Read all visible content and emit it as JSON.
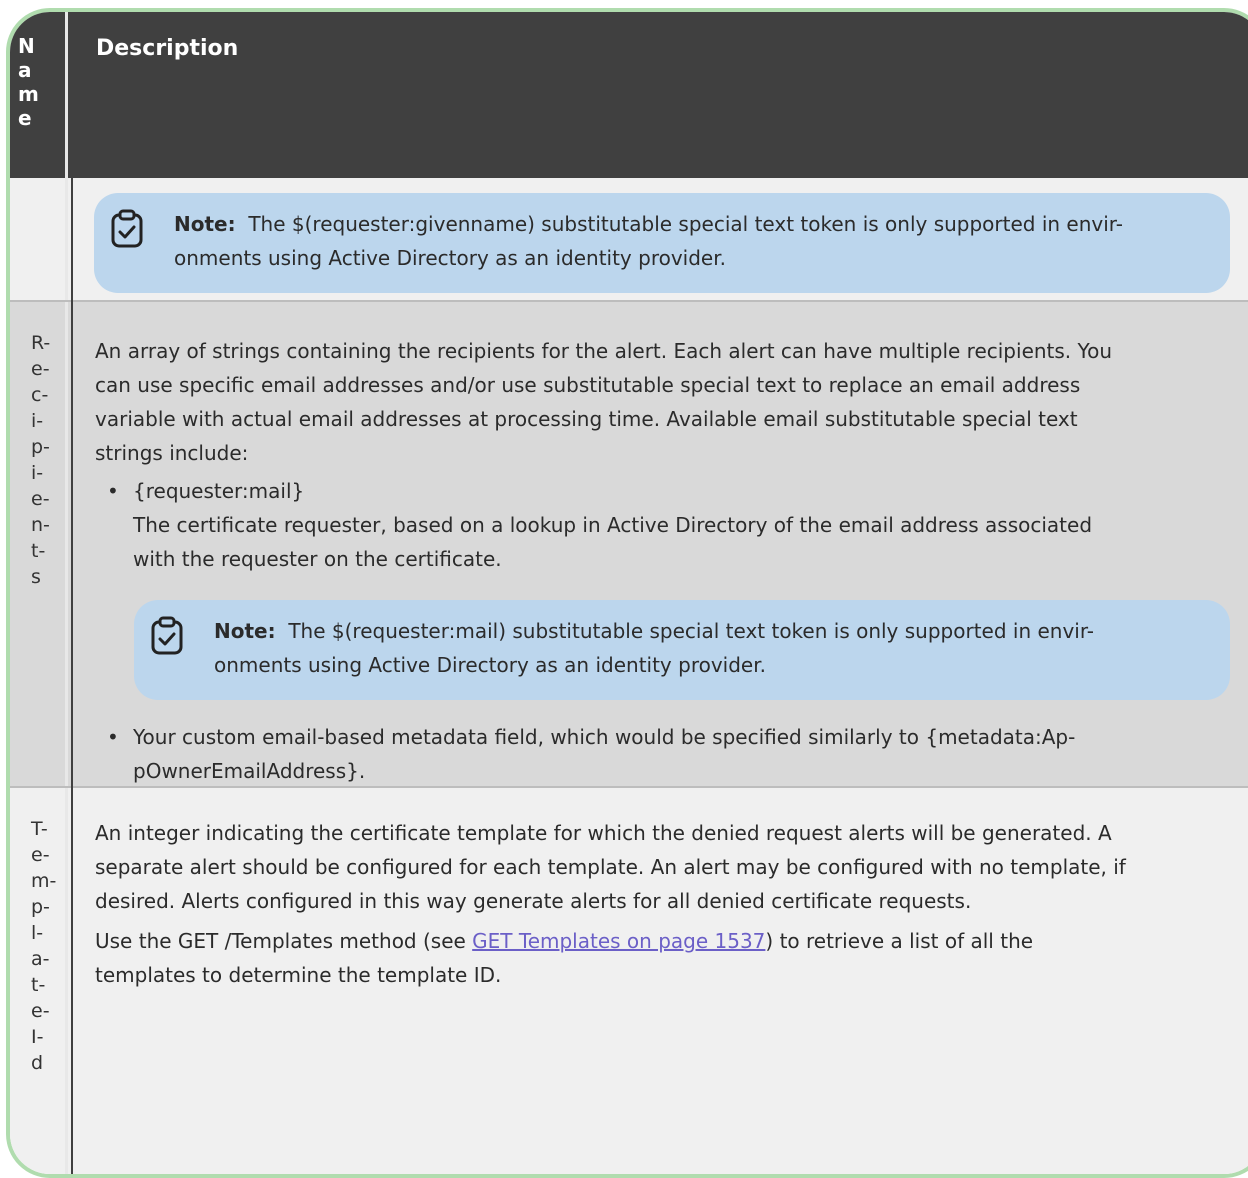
{
  "header": {
    "name_col": "Name",
    "desc_col": "Description"
  },
  "row_note": {
    "note_label": "Note:",
    "note_text": "The $(requester:givenname) substitutable special text token is only supported in envir-",
    "note_text2": "onments using Active Directory as an identity provider."
  },
  "row_recipients": {
    "name_letters": [
      "R-",
      "e-",
      "c-",
      "i-",
      "p-",
      "i-",
      "e-",
      "n-",
      "t-",
      "s"
    ],
    "desc_line1": "An array of strings containing the recipients for the alert. Each alert can have multiple recipients. You",
    "desc_line2": "can use specific email addresses and/or use substitutable special text to replace an email address",
    "desc_line3": "variable with actual email addresses at processing time. Available email substitutable special text",
    "desc_line4": "strings include:",
    "bullet1_title": "{requester:mail}",
    "bullet1_line1": "The certificate requester, based on a lookup in Active Directory of the email address associated",
    "bullet1_line2": "with the requester on the certificate.",
    "note_label": "Note:",
    "note_text": "The $(requester:mail) substitutable special text token is only supported in envir-",
    "note_text2": "onments using Active Directory as an identity provider.",
    "bullet2_line1": "Your custom email-based metadata field, which would be specified similarly to {metadata:Ap-",
    "bullet2_line2": "pOwnerEmailAddress}."
  },
  "row_template": {
    "name_letters": [
      "T-",
      "e-",
      "m-",
      "p-",
      "l-",
      "a-",
      "t-",
      "e-",
      "I-",
      "d"
    ],
    "desc_line1": "An integer indicating the certificate template for which the denied request alerts will be generated. A",
    "desc_line2": "separate alert should be configured for each template. An alert may be configured with no template, if",
    "desc_line3": "desired. Alerts configured in this way generate alerts for all denied certificate requests.",
    "desc_line4_pre": "Use the GET /Templates method (see ",
    "desc_line4_link": "GET Templates on page 1537",
    "desc_line4_post": ") to retrieve a list of all the",
    "desc_line5": "templates to determine the template ID."
  },
  "colors": {
    "header_bg": "#404040",
    "row_light": "#f0f0f0",
    "row_dark": "#d9d9d9",
    "note_bg": "#bcd6ed",
    "frame_border": "#b0dcae",
    "link": "#6b5fc7"
  }
}
